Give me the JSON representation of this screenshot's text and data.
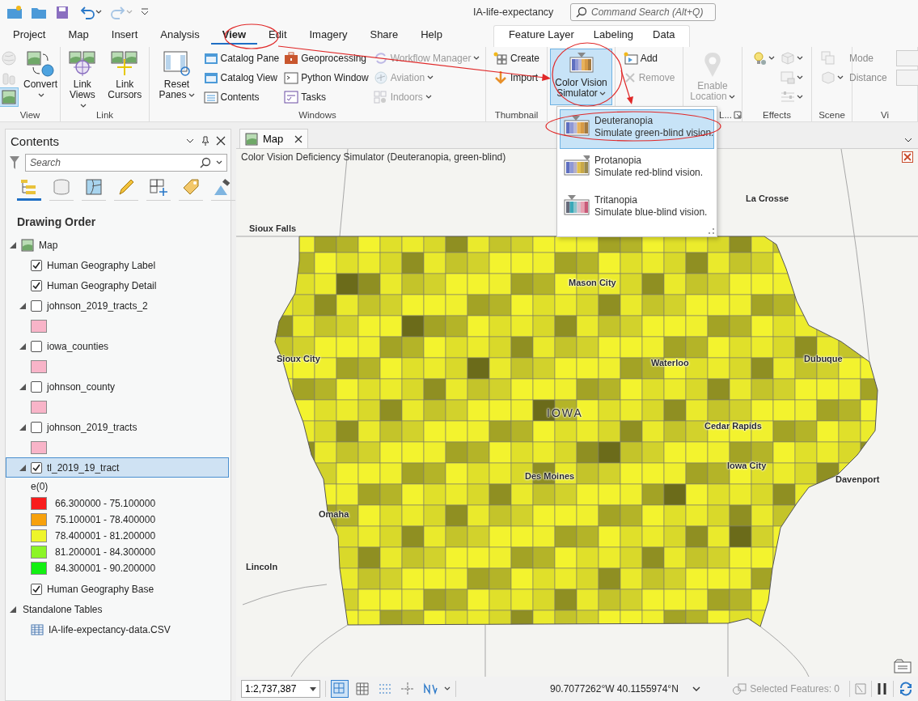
{
  "title_bar": {
    "title": "IA-life-expectancy",
    "search": {
      "placeholder": "Command Search (Alt+Q)"
    },
    "quick_access": [
      {
        "disabled": false
      },
      {
        "disabled": false
      },
      {
        "disabled": false
      },
      {
        "disabled": false
      },
      {
        "disabled": true
      }
    ]
  },
  "ribbon_tabs": [
    {
      "label": "Project",
      "selected": false
    },
    {
      "label": "Map",
      "selected": false
    },
    {
      "label": "Insert",
      "selected": false
    },
    {
      "label": "Analysis",
      "selected": false
    },
    {
      "label": "View",
      "selected": true
    },
    {
      "label": "Edit",
      "selected": false
    },
    {
      "label": "Imagery",
      "selected": false
    },
    {
      "label": "Share",
      "selected": false
    },
    {
      "label": "Help",
      "selected": false
    }
  ],
  "contextual_tabs": [
    {
      "label": "Feature Layer",
      "selected": false
    },
    {
      "label": "Labeling",
      "selected": false
    },
    {
      "label": "Data",
      "selected": false
    }
  ],
  "ribbon_groups": [
    {
      "label": "View",
      "columns": [
        [
          {
            "kind": "icon",
            "dropdown": false,
            "disabled": true,
            "active": false
          },
          {
            "kind": "icon",
            "dropdown": false,
            "disabled": true,
            "active": false
          },
          {
            "kind": "icon",
            "dropdown": false,
            "disabled": false,
            "active": true
          }
        ],
        [
          {
            "kind": "large",
            "label": "Convert",
            "dropdown": true,
            "disabled": false,
            "active": false
          }
        ]
      ]
    },
    {
      "label": "Link",
      "columns": [
        [
          {
            "kind": "large",
            "label": "Link Views",
            "dropdown": true,
            "disabled": false,
            "active": false
          }
        ],
        [
          {
            "kind": "large",
            "label": "Link Cursors",
            "dropdown": false,
            "disabled": false,
            "active": false
          }
        ]
      ]
    },
    {
      "label": "Windows",
      "columns": [
        [
          {
            "kind": "large",
            "label": "Reset Panes",
            "dropdown": true,
            "disabled": false,
            "active": false
          }
        ],
        [
          {
            "kind": "small",
            "label": "Catalog Pane",
            "dropdown": false,
            "disabled": false,
            "active": false
          },
          {
            "kind": "small",
            "label": "Catalog View",
            "dropdown": false,
            "disabled": false,
            "active": false
          },
          {
            "kind": "small",
            "label": "Contents",
            "dropdown": false,
            "disabled": false,
            "active": false
          }
        ],
        [
          {
            "kind": "small",
            "label": "Geoprocessing",
            "dropdown": false,
            "disabled": false,
            "active": false
          },
          {
            "kind": "small",
            "label": "Python Window",
            "dropdown": false,
            "disabled": false,
            "active": false
          },
          {
            "kind": "small",
            "label": "Tasks",
            "dropdown": false,
            "disabled": false,
            "active": false
          }
        ],
        [
          {
            "kind": "small",
            "label": "Workflow Manager",
            "dropdown": true,
            "disabled": true,
            "active": false
          },
          {
            "kind": "small",
            "label": "Aviation",
            "dropdown": true,
            "disabled": true,
            "active": false
          },
          {
            "kind": "small",
            "label": "Indoors",
            "dropdown": true,
            "disabled": true,
            "active": false
          }
        ]
      ]
    },
    {
      "label": "Thumbnail",
      "columns": [
        [
          {
            "kind": "small",
            "label": "Create",
            "dropdown": false,
            "disabled": false,
            "active": false
          },
          {
            "kind": "small",
            "label": "Import",
            "dropdown": false,
            "disabled": false,
            "active": false
          }
        ]
      ]
    },
    {
      "columns": [
        [
          {
            "kind": "large",
            "label": "Color Vision Simulator",
            "dropdown": true,
            "disabled": false,
            "active": true
          }
        ]
      ]
    },
    {
      "columns": [
        [
          {
            "kind": "small",
            "label": "Add",
            "dropdown": false,
            "disabled": false,
            "active": false
          },
          {
            "kind": "small",
            "label": "Remove",
            "dropdown": false,
            "disabled": true,
            "active": false
          }
        ]
      ]
    },
    {
      "label": "L...",
      "launcher": true,
      "columns": [
        [
          {
            "kind": "large",
            "label": "Enable Location",
            "dropdown": true,
            "disabled": true,
            "active": false
          }
        ]
      ]
    },
    {
      "label": "Effects",
      "columns": [
        [
          {
            "kind": "icon",
            "dropdown": true,
            "disabled": false,
            "active": false
          }
        ],
        [
          {
            "kind": "icon",
            "dropdown": true,
            "disabled": true,
            "active": false
          },
          {
            "kind": "icon",
            "dropdown": true,
            "disabled": true,
            "active": false
          },
          {
            "kind": "icon",
            "dropdown": true,
            "disabled": true,
            "active": false
          }
        ]
      ]
    },
    {
      "label": "Scene",
      "columns": [
        [
          {
            "kind": "icon",
            "dropdown": false,
            "disabled": true,
            "active": false
          },
          {
            "kind": "icon",
            "dropdown": true,
            "disabled": true,
            "active": false
          }
        ]
      ]
    },
    {
      "label": "Vi",
      "columns": [
        [
          {
            "kind": "field",
            "label": "Mode",
            "disabled": true
          },
          {
            "kind": "field",
            "label": "Distance",
            "disabled": true
          }
        ]
      ]
    }
  ],
  "simulator_menu": {
    "items": [
      {
        "label": "Deuteranopia",
        "description": "Simulate green-blind vision.",
        "selected": true
      },
      {
        "label": "Protanopia",
        "description": "Simulate red-blind vision.",
        "selected": false
      },
      {
        "label": "Tritanopia",
        "description": "Simulate blue-blind vision.",
        "selected": false
      }
    ]
  },
  "contents": {
    "title": "Contents",
    "search": {
      "placeholder": "Search"
    },
    "views": [
      {
        "selected": true
      },
      {
        "selected": false
      },
      {
        "selected": false
      },
      {
        "selected": false
      },
      {
        "selected": false
      },
      {
        "selected": false
      },
      {
        "selected": false
      }
    ],
    "heading": "Drawing Order",
    "tree": [
      {
        "label": "Map",
        "kind": "map",
        "expanded": true,
        "selected": false,
        "children": [
          {
            "label": "Human Geography Label",
            "kind": "basemap",
            "checked": true,
            "selected": false
          },
          {
            "label": "Human Geography Detail",
            "kind": "basemap",
            "checked": true,
            "selected": false
          },
          {
            "label": "johnson_2019_tracts_2",
            "kind": "feature",
            "checked": false,
            "expanded": true,
            "selected": false
          },
          {
            "label": "iowa_counties",
            "kind": "feature",
            "checked": false,
            "expanded": true,
            "selected": false
          },
          {
            "label": "johnson_county",
            "kind": "feature",
            "checked": false,
            "expanded": true,
            "selected": false
          },
          {
            "label": "johnson_2019_tracts",
            "kind": "feature",
            "checked": false,
            "expanded": true,
            "selected": false
          },
          {
            "label": "tl_2019_19_tract",
            "kind": "classed",
            "checked": true,
            "expanded": true,
            "selected": true,
            "legend": {
              "field": "e(0)",
              "classes": [
                {
                  "label": "66.300000 - 75.100000",
                  "color": "#f81c1c"
                },
                {
                  "label": "75.100001 - 78.400000",
                  "color": "#f7a10c"
                },
                {
                  "label": "78.400001 - 81.200000",
                  "color": "#eef52a"
                },
                {
                  "label": "81.200001 - 84.300000",
                  "color": "#8cf526"
                },
                {
                  "label": "84.300001 - 90.200000",
                  "color": "#12f012"
                }
              ]
            }
          },
          {
            "label": "Human Geography Base",
            "kind": "basemap",
            "checked": true,
            "selected": false
          }
        ]
      },
      {
        "label": "Standalone Tables",
        "kind": "group",
        "expanded": true,
        "selected": false,
        "children": [
          {
            "label": "IA-life-expectancy-data.CSV",
            "kind": "table",
            "selected": false
          }
        ]
      }
    ]
  },
  "map_view": {
    "tabs": [
      {
        "label": "Map",
        "selected": true
      }
    ],
    "caption": "Color Vision Deficiency Simulator (Deuteranopia, green-blind)",
    "places": [
      {
        "label": "Sioux Falls",
        "kind": "city"
      },
      {
        "label": "La Crosse",
        "kind": "city"
      },
      {
        "label": "Mason City",
        "kind": "city"
      },
      {
        "label": "Sioux City",
        "kind": "city"
      },
      {
        "label": "Waterloo",
        "kind": "city"
      },
      {
        "label": "Dubuque",
        "kind": "city"
      },
      {
        "label": "IOWA",
        "kind": "state"
      },
      {
        "label": "Cedar Rapids",
        "kind": "city"
      },
      {
        "label": "Iowa City",
        "kind": "city"
      },
      {
        "label": "Des Moines",
        "kind": "city"
      },
      {
        "label": "Davenport",
        "kind": "city"
      },
      {
        "label": "Omaha",
        "kind": "city"
      },
      {
        "label": "Lincoln",
        "kind": "city"
      }
    ],
    "status_bar": {
      "scale": "1:2,737,387",
      "tools": [
        {
          "selected": true
        },
        {
          "selected": false
        },
        {
          "selected": false
        },
        {
          "selected": false
        },
        {
          "selected": false
        }
      ],
      "coordinates": "90.7077262°W 40.1155974°N",
      "selected_features": "Selected Features: 0"
    }
  }
}
